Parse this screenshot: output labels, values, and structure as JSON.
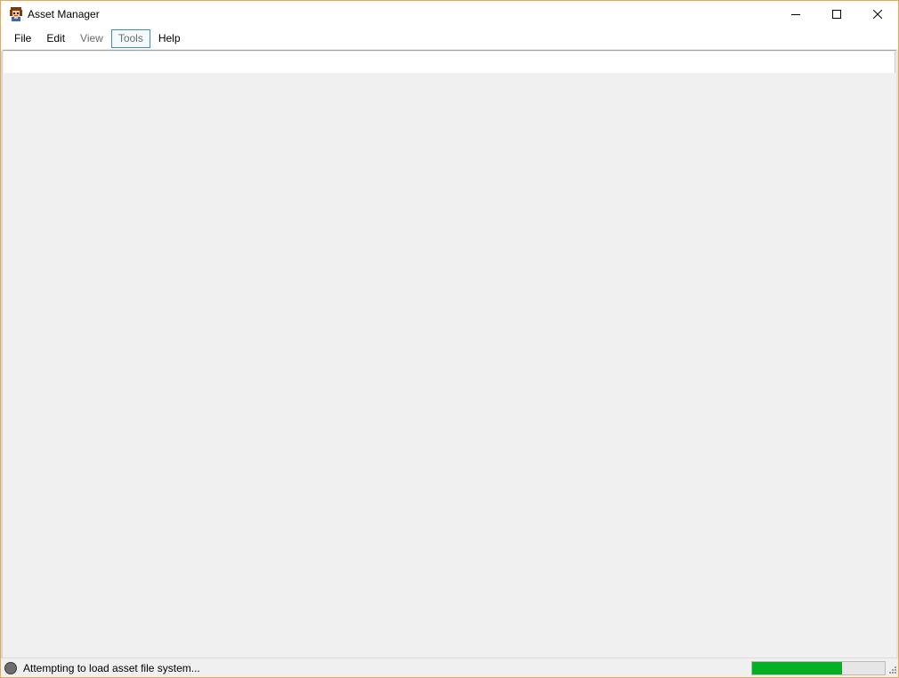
{
  "window": {
    "title": "Asset Manager",
    "app_icon": "character-face-icon",
    "controls": {
      "minimize_icon": "minimize-icon",
      "maximize_icon": "maximize-icon",
      "close_icon": "close-icon"
    }
  },
  "menubar": {
    "items": [
      {
        "label": "File",
        "state": "enabled"
      },
      {
        "label": "Edit",
        "state": "enabled"
      },
      {
        "label": "View",
        "state": "disabled"
      },
      {
        "label": "Tools",
        "state": "focused"
      },
      {
        "label": "Help",
        "state": "enabled"
      }
    ]
  },
  "toolbar": {
    "field_value": ""
  },
  "statusbar": {
    "indicator_icon": "status-circle-icon",
    "message": "Attempting to load asset file system...",
    "progress_percent": 68,
    "progress_color": "#06b025",
    "grip_icon": "resize-grip-icon"
  },
  "colors": {
    "window_border": "#e8a952",
    "focus_border": "#3c8ac8",
    "background": "#f0f0f0"
  }
}
